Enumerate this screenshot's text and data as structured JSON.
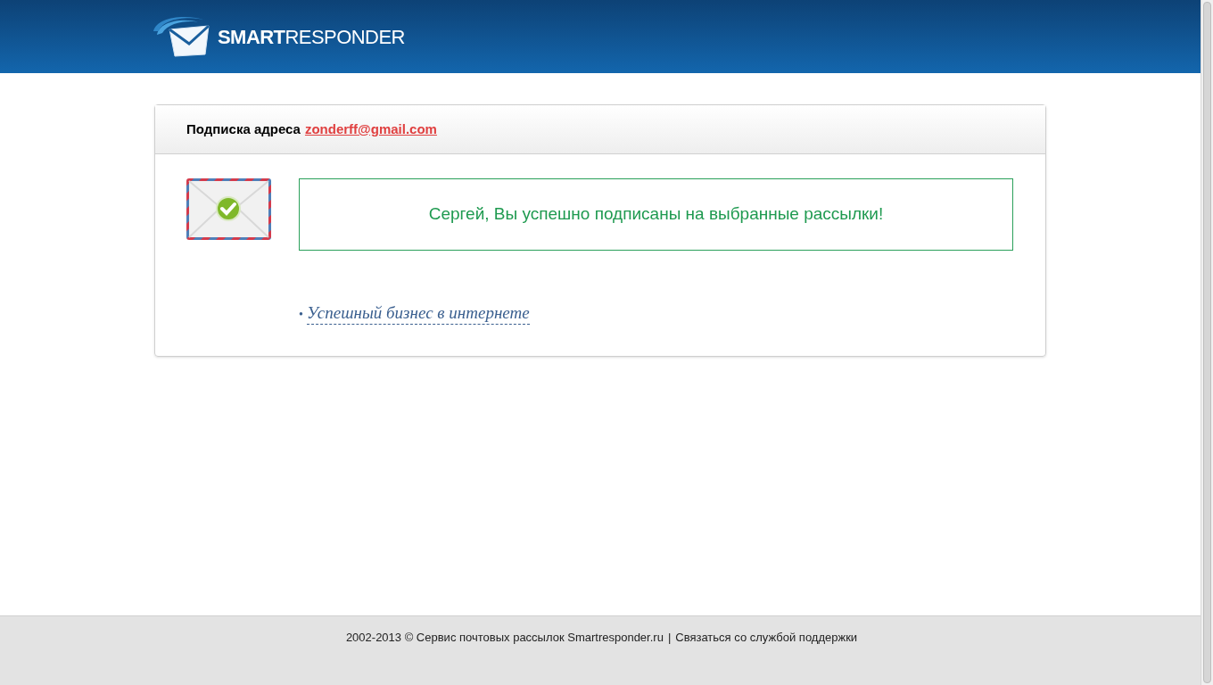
{
  "header": {
    "logo": "**SMART**RESPONDER"
  },
  "card": {
    "title": "Подписка адреса",
    "email": "zonderff@gmail.com",
    "message": "Сергей, Вы успешно подписаны на выбранные рассылки!",
    "bullet": "•",
    "links": [
      "Успешный бизнес в интернете"
    ]
  },
  "footer": {
    "copyright": "2002-2013 © Сервис почтовых рассылок Smartresponder.ru",
    "separator": "|",
    "support": "Связаться со службой поддержки"
  }
}
